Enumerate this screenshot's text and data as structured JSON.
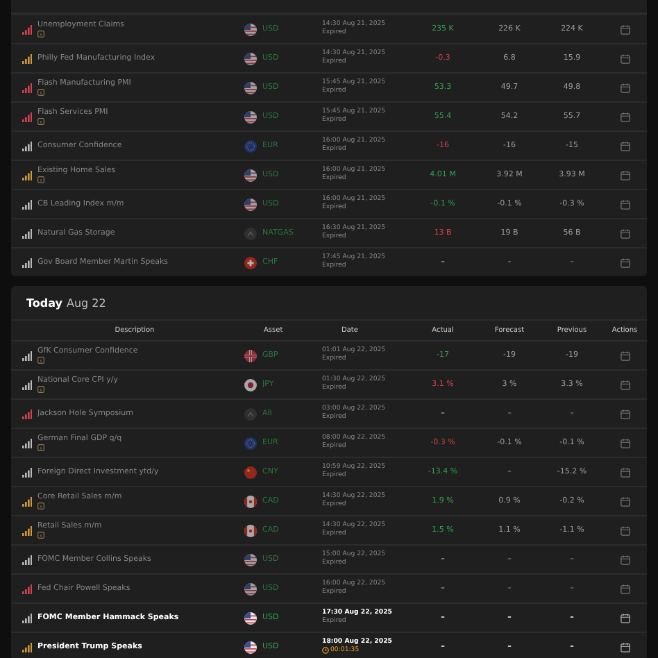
{
  "sections": [
    {
      "rows": [
        {
          "description": "Unemployment Claims",
          "impact": {
            "color": "#d2424f"
          },
          "info": true,
          "flag": {
            "kind": "us"
          },
          "asset": "USD",
          "date": "14:30 Aug 21, 2025",
          "status": "Expired",
          "actual": {
            "value": "235 K",
            "color": "#2fa24c"
          },
          "forecast": "226 K",
          "previous": "224 K",
          "dimmed": true
        },
        {
          "description": "Philly Fed Manufacturing Index",
          "impact": {
            "color": "#d09a3a"
          },
          "info": false,
          "flag": {
            "kind": "us"
          },
          "asset": "USD",
          "date": "14:30 Aug 21, 2025",
          "status": "Expired",
          "actual": {
            "value": "-0.3",
            "color": "#d2424f"
          },
          "forecast": "6.8",
          "previous": "15.9",
          "dimmed": true
        },
        {
          "description": "Flash Manufacturing PMI",
          "impact": {
            "color": "#d2424f"
          },
          "info": true,
          "flag": {
            "kind": "us"
          },
          "asset": "USD",
          "date": "15:45 Aug 21, 2025",
          "status": "Expired",
          "actual": {
            "value": "53.3",
            "color": "#2fa24c"
          },
          "forecast": "49.7",
          "previous": "49.8",
          "dimmed": true
        },
        {
          "description": "Flash Services PMI",
          "impact": {
            "color": "#d2424f"
          },
          "info": true,
          "flag": {
            "kind": "us"
          },
          "asset": "USD",
          "date": "15:45 Aug 21, 2025",
          "status": "Expired",
          "actual": {
            "value": "55.4",
            "color": "#2fa24c"
          },
          "forecast": "54.2",
          "previous": "55.7",
          "dimmed": true
        },
        {
          "description": "Consumer Confidence",
          "impact": {
            "color": "#b9b9b9"
          },
          "info": false,
          "flag": {
            "kind": "eu"
          },
          "asset": "EUR",
          "date": "16:00 Aug 21, 2025",
          "status": "Expired",
          "actual": {
            "value": "-16",
            "color": "#d2424f"
          },
          "forecast": "-16",
          "previous": "-15",
          "dimmed": true
        },
        {
          "description": "Existing Home Sales",
          "impact": {
            "color": "#d09a3a"
          },
          "info": true,
          "flag": {
            "kind": "us"
          },
          "asset": "USD",
          "date": "16:00 Aug 21, 2025",
          "status": "Expired",
          "actual": {
            "value": "4.01 M",
            "color": "#2fa24c"
          },
          "forecast": "3.92 M",
          "previous": "3.93 M",
          "dimmed": true
        },
        {
          "description": "CB Leading Index m/m",
          "impact": {
            "color": "#b9b9b9"
          },
          "info": false,
          "flag": {
            "kind": "us"
          },
          "asset": "USD",
          "date": "16:00 Aug 21, 2025",
          "status": "Expired",
          "actual": {
            "value": "-0.1 %",
            "color": "#2fa24c"
          },
          "forecast": "-0.1 %",
          "previous": "-0.3 %",
          "dimmed": true
        },
        {
          "description": "Natural Gas Storage",
          "impact": {
            "color": "#b9b9b9"
          },
          "info": false,
          "flag": {
            "kind": "none"
          },
          "asset": "NATGAS",
          "date": "16:30 Aug 21, 2025",
          "status": "Expired",
          "actual": {
            "value": "13 B",
            "color": "#d2424f"
          },
          "forecast": "19 B",
          "previous": "56 B",
          "dimmed": true
        },
        {
          "description": "Gov Board Member Martin Speaks",
          "impact": {
            "color": "#b9b9b9"
          },
          "info": false,
          "flag": {
            "kind": "ch"
          },
          "asset": "CHF",
          "date": "17:45 Aug 21, 2025",
          "status": "Expired",
          "actual": {
            "value": "–"
          },
          "forecast": "–",
          "previous": "–",
          "dimmed": true
        }
      ]
    },
    {
      "heading": {
        "day": "Today",
        "date": "Aug 22"
      },
      "columns": [
        "Description",
        "Asset",
        "Date",
        "Actual",
        "Forecast",
        "Previous",
        "Actions"
      ],
      "rows": [
        {
          "description": "GfK Consumer Confidence",
          "impact": {
            "color": "#b9b9b9"
          },
          "info": true,
          "flag": {
            "kind": "gb"
          },
          "asset": "GBP",
          "date": "01:01 Aug 22, 2025",
          "status": "Expired",
          "actual": {
            "value": "-17",
            "color": "#2fa24c"
          },
          "forecast": "-19",
          "previous": "-19",
          "dimmed": true
        },
        {
          "description": "National Core CPI y/y",
          "impact": {
            "color": "#b9b9b9"
          },
          "info": true,
          "flag": {
            "kind": "jp"
          },
          "asset": "JPY",
          "date": "01:30 Aug 22, 2025",
          "status": "Expired",
          "actual": {
            "value": "3.1 %",
            "color": "#d2424f"
          },
          "forecast": "3 %",
          "previous": "3.3 %",
          "dimmed": true
        },
        {
          "description": "Jackson Hole Symposium",
          "impact": {
            "color": "#d2424f"
          },
          "info": false,
          "flag": {
            "kind": "none"
          },
          "asset": "All",
          "date": "03:00 Aug 22, 2025",
          "status": "Expired",
          "actual": {
            "value": "–"
          },
          "forecast": "–",
          "previous": "–",
          "dimmed": true
        },
        {
          "description": "German Final GDP q/q",
          "impact": {
            "color": "#b9b9b9"
          },
          "info": true,
          "flag": {
            "kind": "eu"
          },
          "asset": "EUR",
          "date": "08:00 Aug 22, 2025",
          "status": "Expired",
          "actual": {
            "value": "-0.3 %",
            "color": "#d2424f"
          },
          "forecast": "-0.1 %",
          "previous": "-0.1 %",
          "dimmed": true
        },
        {
          "description": "Foreign Direct Investment ytd/y",
          "impact": {
            "color": "#b9b9b9"
          },
          "info": false,
          "flag": {
            "kind": "cn"
          },
          "asset": "CNY",
          "date": "10:59 Aug 22, 2025",
          "status": "Expired",
          "actual": {
            "value": "-13.4 %",
            "color": "#2fa24c"
          },
          "forecast": "–",
          "previous": "-15.2 %",
          "dimmed": true
        },
        {
          "description": "Core Retail Sales m/m",
          "impact": {
            "color": "#d09a3a"
          },
          "info": true,
          "flag": {
            "kind": "ca"
          },
          "asset": "CAD",
          "date": "14:30 Aug 22, 2025",
          "status": "Expired",
          "actual": {
            "value": "1.9 %",
            "color": "#2fa24c"
          },
          "forecast": "0.9 %",
          "previous": "-0.2 %",
          "dimmed": true
        },
        {
          "description": "Retail Sales m/m",
          "impact": {
            "color": "#d09a3a"
          },
          "info": true,
          "flag": {
            "kind": "ca"
          },
          "asset": "CAD",
          "date": "14:30 Aug 22, 2025",
          "status": "Expired",
          "actual": {
            "value": "1.5 %",
            "color": "#2fa24c"
          },
          "forecast": "1.1 %",
          "previous": "-1.1 %",
          "dimmed": true
        },
        {
          "description": "FOMC Member Collins Speaks",
          "impact": {
            "color": "#b9b9b9"
          },
          "info": false,
          "flag": {
            "kind": "us"
          },
          "asset": "USD",
          "date": "15:00 Aug 22, 2025",
          "status": "Expired",
          "actual": {
            "value": "–"
          },
          "forecast": "–",
          "previous": "–",
          "dimmed": true
        },
        {
          "description": "Fed Chair Powell Speaks",
          "impact": {
            "color": "#d2424f"
          },
          "info": false,
          "flag": {
            "kind": "us"
          },
          "asset": "USD",
          "date": "16:00 Aug 22, 2025",
          "status": "Expired",
          "actual": {
            "value": "–"
          },
          "forecast": "–",
          "previous": "–",
          "dimmed": true
        },
        {
          "description": "FOMC Member Hammack Speaks",
          "impact": {
            "color": "#b9b9b9"
          },
          "info": false,
          "flag": {
            "kind": "us"
          },
          "asset": "USD",
          "date": "17:30 Aug 22, 2025",
          "status": "Expired",
          "actual": {
            "value": "–"
          },
          "forecast": "–",
          "previous": "–",
          "dimmed": false
        },
        {
          "description": "President Trump Speaks",
          "impact": {
            "color": "#d09a3a"
          },
          "info": false,
          "flag": {
            "kind": "us"
          },
          "asset": "USD",
          "date": "18:00 Aug 22, 2025",
          "countdown": "00:01:35",
          "actual": {
            "value": "–"
          },
          "forecast": "–",
          "previous": "–",
          "dimmed": false
        }
      ]
    }
  ]
}
